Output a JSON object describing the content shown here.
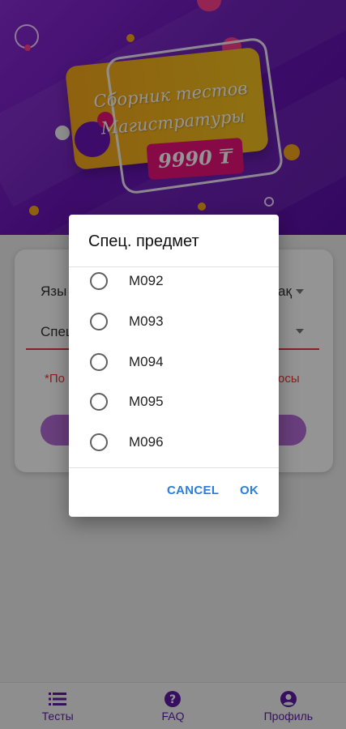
{
  "banner": {
    "title_line1": "Сборник тестов",
    "title_line2": "Магистратуры",
    "price": "9990 ₸"
  },
  "form": {
    "language_label_fragment": "Язы",
    "language_value_fragment": "ақ",
    "subject_label_fragment": "Спец",
    "error_left_fragment": "*По",
    "error_right_fragment": "осы"
  },
  "dialog": {
    "title": "Спец. предмет",
    "options": [
      "M092",
      "M093",
      "M094",
      "M095",
      "M096"
    ],
    "cancel_label": "CANCEL",
    "ok_label": "OK"
  },
  "bottom_nav": {
    "items": [
      {
        "label": "Тесты",
        "icon": "list-icon"
      },
      {
        "label": "FAQ",
        "icon": "help-circle-icon"
      },
      {
        "label": "Профиль",
        "icon": "account-icon"
      }
    ]
  },
  "colors": {
    "accent": "#5e1aa6",
    "dialog_button": "#2b7de0",
    "error": "#e53935",
    "price_tag": "#e8127a",
    "promo_card": "#f4b31e"
  }
}
